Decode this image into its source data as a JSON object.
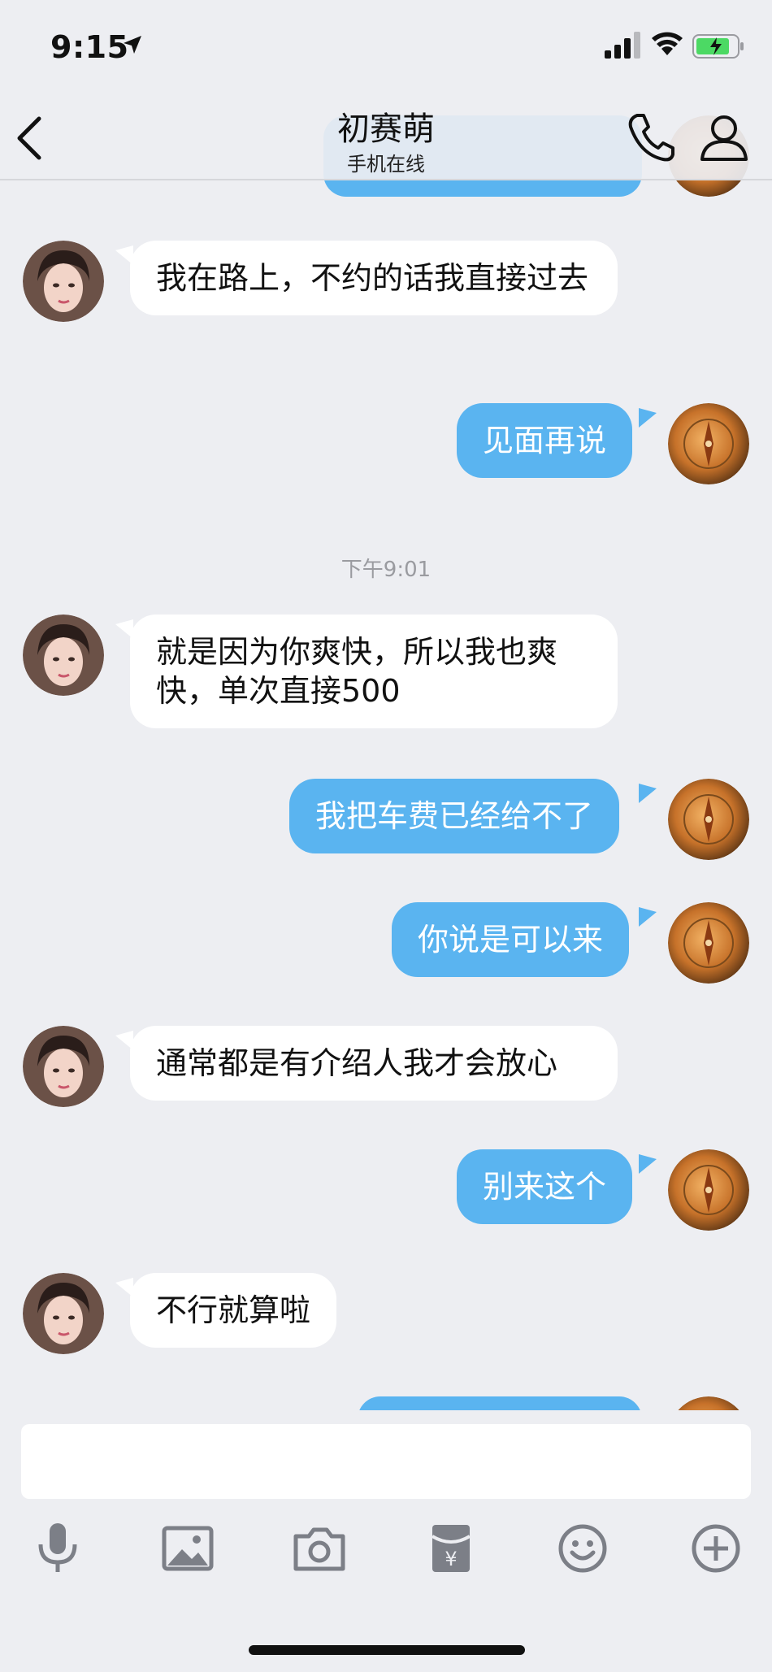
{
  "status_bar": {
    "time": "9:15"
  },
  "header": {
    "title": "初赛萌",
    "subtitle": "手机在线"
  },
  "messages": [
    {
      "side": "in",
      "text": "我在路上，不约的话我直接过去"
    },
    {
      "side": "out",
      "text": "见面再说"
    },
    {
      "side": "in",
      "text": "就是因为你爽快，所以我也爽快，单次直接500"
    },
    {
      "side": "out",
      "text": "我把车费已经给不了"
    },
    {
      "side": "out",
      "text": "你说是可以来"
    },
    {
      "side": "in",
      "text": "通常都是有介绍人我才会放心"
    },
    {
      "side": "out",
      "text": "别来这个"
    },
    {
      "side": "in",
      "text": "不行就算啦"
    }
  ],
  "timestamp": "下午9:01",
  "input": {
    "placeholder": ""
  },
  "toolbar": [
    "mic-icon",
    "image-icon",
    "camera-icon",
    "red-packet-icon",
    "emoji-icon",
    "plus-icon"
  ],
  "colors": {
    "out_bubble": "#5ab4f0",
    "in_bubble": "#ffffff",
    "background": "#edeef2"
  }
}
